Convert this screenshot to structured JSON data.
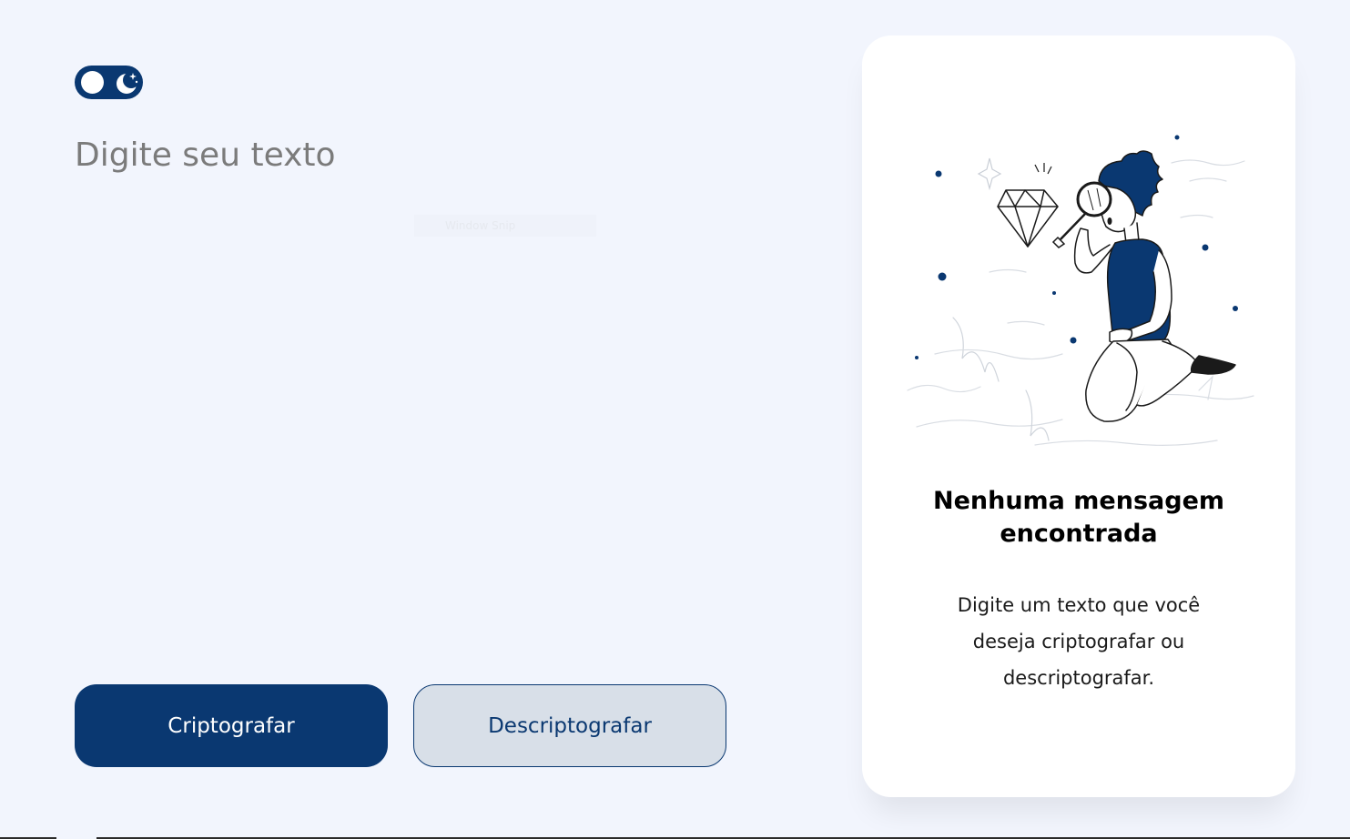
{
  "theme_toggle": {
    "icon_on": "sun-circle-icon",
    "icon_off": "moon-stars-icon"
  },
  "input": {
    "placeholder": "Digite seu texto",
    "value": ""
  },
  "overlay_hint": "Window Snip",
  "buttons": {
    "encrypt_label": "Criptografar",
    "decrypt_label": "Descriptografar"
  },
  "output": {
    "title": "Nenhuma mensagem encontrada",
    "message": "Digite um texto que você deseja criptografar ou descriptografar.",
    "illustration": "person-searching-diamond-illustration"
  },
  "colors": {
    "background": "#f2f5fd",
    "primary": "#0a3871",
    "secondary_button_bg": "#d8dfe8",
    "card": "#ffffff"
  }
}
